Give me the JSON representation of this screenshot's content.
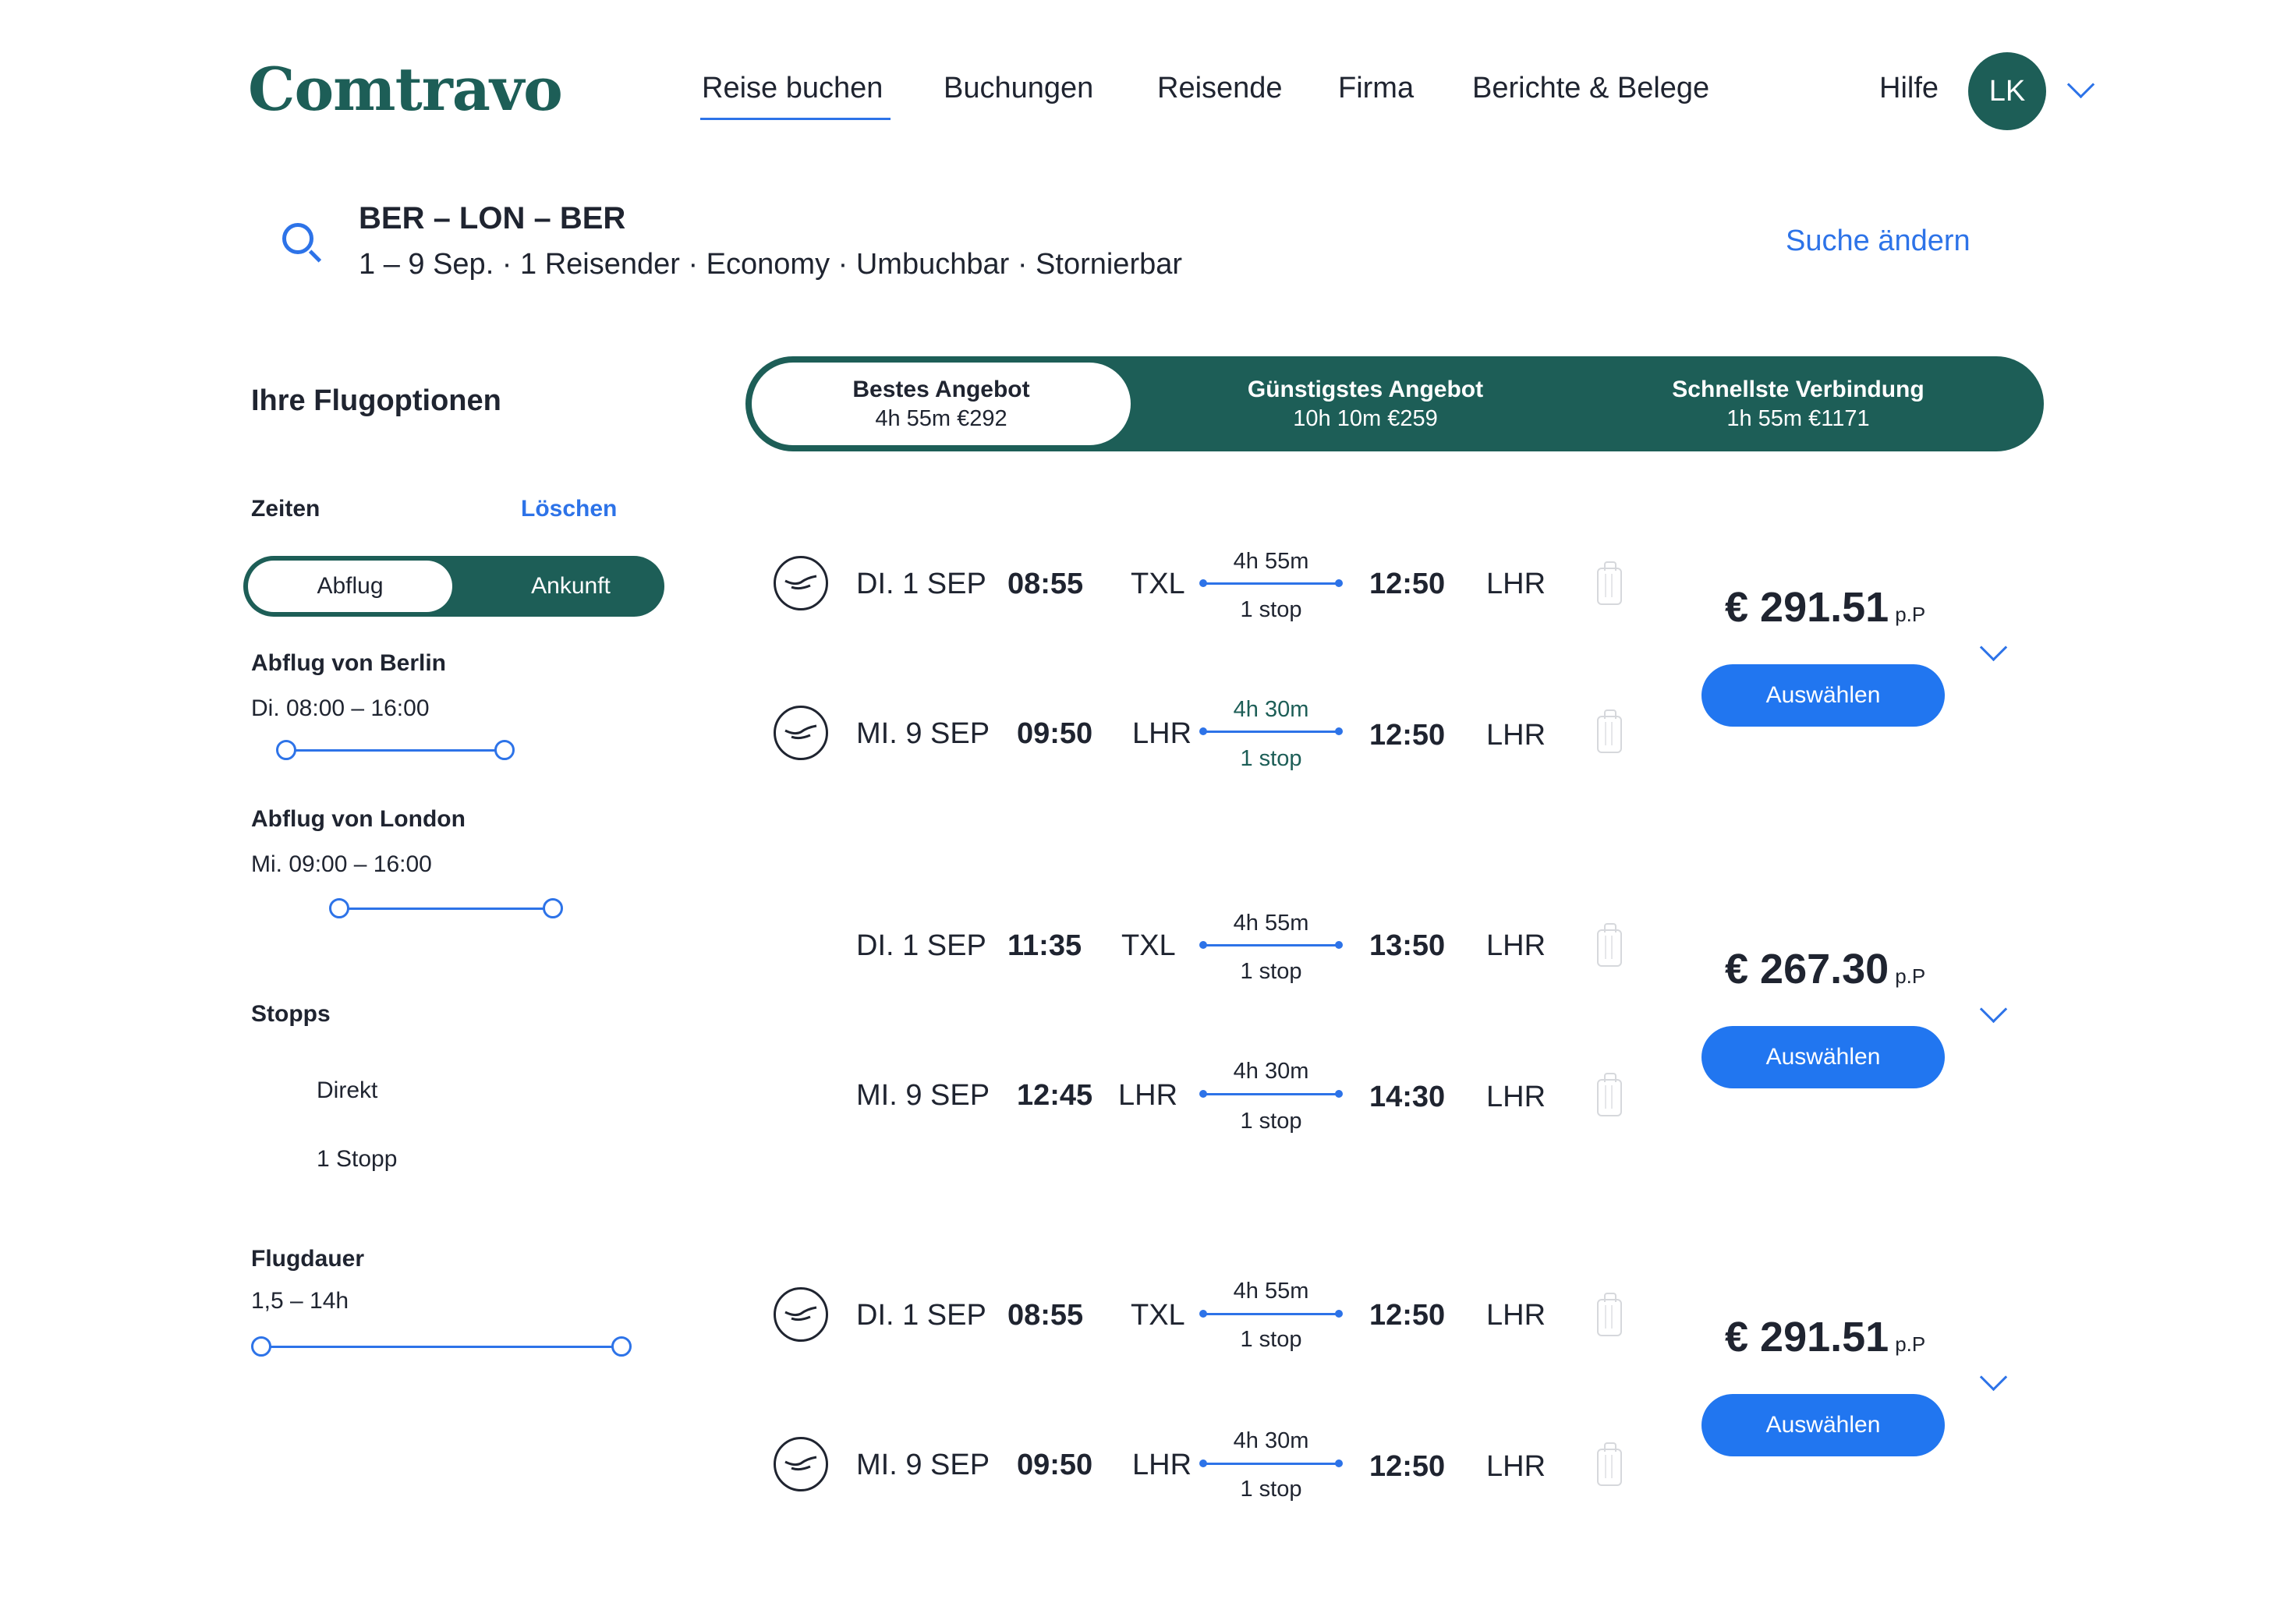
{
  "header": {
    "logo": "Comtravo",
    "nav": [
      "Reise buchen",
      "Buchungen",
      "Reisende",
      "Firma",
      "Berichte & Belege"
    ],
    "help": "Hilfe",
    "avatar_initials": "LK"
  },
  "search": {
    "route": "BER – LON – BER",
    "details": "1 – 9 Sep. · 1 Reisender · Economy · Umbuchbar · Stornierbar",
    "change_label": "Suche ändern"
  },
  "sidebar": {
    "title": "Ihre Flugoptionen",
    "times_label": "Zeiten",
    "clear_label": "Löschen",
    "toggle": [
      "Abflug",
      "Ankunft"
    ],
    "berlin_label": "Abflug von Berlin",
    "berlin_range": "Di. 08:00 – 16:00",
    "london_label": "Abflug von London",
    "london_range": "Mi. 09:00 – 16:00",
    "stops_label": "Stopps",
    "stops_options": [
      "Direkt",
      "1 Stopp"
    ],
    "duration_label": "Flugdauer",
    "duration_range": "1,5 – 14h"
  },
  "tabs": [
    {
      "title": "Bestes Angebot",
      "sub": "4h 55m €292"
    },
    {
      "title": "Günstigstes Angebot",
      "sub": "10h 10m €259"
    },
    {
      "title": "Schnellste Verbindung",
      "sub": "1h 55m €1171"
    }
  ],
  "results": [
    {
      "price": "€ 291.51",
      "pp": "p.P",
      "button": "Auswählen",
      "legs": [
        {
          "date": "DI. 1 SEP",
          "dep": "08:55",
          "from": "TXL",
          "dur": "4h 55m",
          "stops": "1 stop",
          "arr": "12:50",
          "to": "LHR"
        },
        {
          "date": "MI. 9 SEP",
          "dep": "09:50",
          "from": "LHR",
          "dur": "4h 30m",
          "stops": "1 stop",
          "arr": "12:50",
          "to": "LHR"
        }
      ]
    },
    {
      "price": "€ 267.30",
      "pp": "p.P",
      "button": "Auswählen",
      "legs": [
        {
          "date": "DI. 1 SEP",
          "dep": "11:35",
          "from": "TXL",
          "dur": "4h 55m",
          "stops": "1 stop",
          "arr": "13:50",
          "to": "LHR"
        },
        {
          "date": "MI. 9 SEP",
          "dep": "12:45",
          "from": "LHR",
          "dur": "4h 30m",
          "stops": "1 stop",
          "arr": "14:30",
          "to": "LHR"
        }
      ]
    },
    {
      "price": "€ 291.51",
      "pp": "p.P",
      "button": "Auswählen",
      "legs": [
        {
          "date": "DI. 1 SEP",
          "dep": "08:55",
          "from": "TXL",
          "dur": "4h 55m",
          "stops": "1 stop",
          "arr": "12:50",
          "to": "LHR"
        },
        {
          "date": "MI. 9 SEP",
          "dep": "09:50",
          "from": "LHR",
          "dur": "4h 30m",
          "stops": "1 stop",
          "arr": "12:50",
          "to": "LHR"
        }
      ]
    }
  ],
  "colors": {
    "brand": "#1d5e57",
    "accent": "#2d73e8",
    "button": "#2176f0"
  }
}
